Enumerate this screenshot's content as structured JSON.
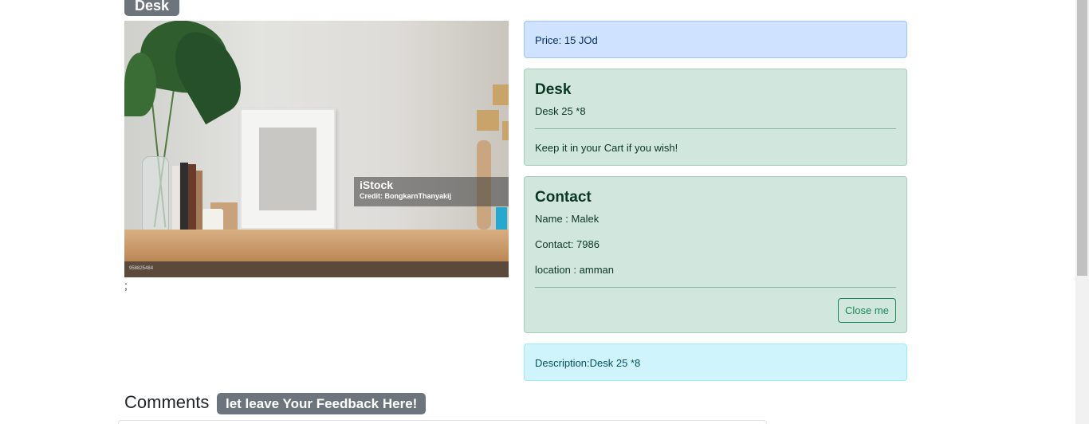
{
  "product": {
    "title_badge": "Desk",
    "image": {
      "watermark_brand": "iStock",
      "watermark_credit": "Credit: BongkarnThanyakij",
      "stock_id": "958825484"
    },
    "after_image_text": ";"
  },
  "price_alert": {
    "text": "Price: 15 JOd"
  },
  "desk_card": {
    "heading": "Desk",
    "subtitle": "Desk 25 *8",
    "message": "Keep it in your Cart if you wish!"
  },
  "contact_card": {
    "heading": "Contact",
    "name": "Name : Malek",
    "contact": "Contact: 7986",
    "location": "location : amman",
    "close_label": "Close me"
  },
  "description_alert": {
    "text": "Description:Desk 25 *8"
  },
  "comments": {
    "title": "Comments",
    "feedback_badge": "let leave Your Feedback Here!"
  }
}
